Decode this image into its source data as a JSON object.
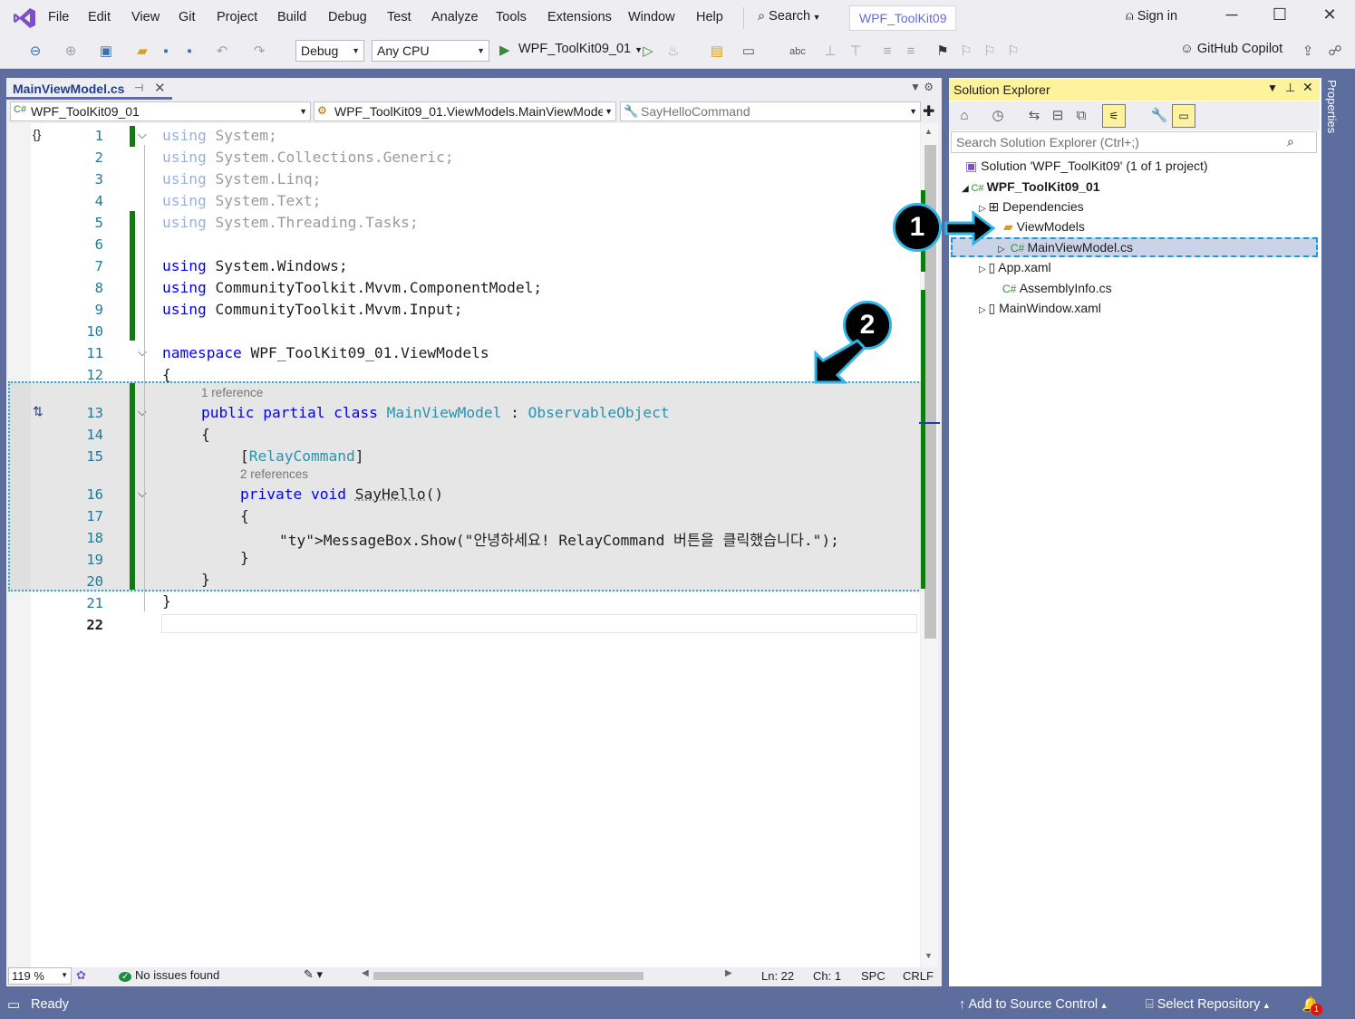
{
  "menubar": {
    "items": [
      "File",
      "Edit",
      "View",
      "Git",
      "Project",
      "Build",
      "Debug",
      "Test",
      "Analyze",
      "Tools",
      "Extensions",
      "Window",
      "Help"
    ],
    "search": "Search",
    "solution_title": "WPF_ToolKit09",
    "sign_in": "Sign in"
  },
  "toolbar": {
    "config": "Debug",
    "platform": "Any CPU",
    "startup_project": "WPF_ToolKit09_01",
    "copilot": "GitHub Copilot"
  },
  "editor": {
    "tab_label": "MainViewModel.cs",
    "nav_project": "WPF_ToolKit09_01",
    "nav_type": "WPF_ToolKit09_01.ViewModels.MainViewModel",
    "nav_member": "SayHelloCommand",
    "lines": [
      {
        "n": "1",
        "text": "using System;"
      },
      {
        "n": "2",
        "text": "using System.Collections.Generic;"
      },
      {
        "n": "3",
        "text": "using System.Linq;"
      },
      {
        "n": "4",
        "text": "using System.Text;"
      },
      {
        "n": "5",
        "text": "using System.Threading.Tasks;"
      },
      {
        "n": "6",
        "text": ""
      },
      {
        "n": "7",
        "text": "using System.Windows;"
      },
      {
        "n": "8",
        "text": "using CommunityToolkit.Mvvm.ComponentModel;"
      },
      {
        "n": "9",
        "text": "using CommunityToolkit.Mvvm.Input;"
      },
      {
        "n": "10",
        "text": ""
      },
      {
        "n": "11",
        "text": "namespace WPF_ToolKit09_01.ViewModels"
      },
      {
        "n": "12",
        "text": "{"
      },
      {
        "n": "13",
        "text": "public partial class MainViewModel : ObservableObject"
      },
      {
        "n": "14",
        "text": "{"
      },
      {
        "n": "15",
        "text": "[RelayCommand]"
      },
      {
        "n": "16",
        "text": "private void SayHello()"
      },
      {
        "n": "17",
        "text": "{"
      },
      {
        "n": "18",
        "text": "MessageBox.Show(\"안녕하세요! RelayCommand 버튼을 클릭했습니다.\");"
      },
      {
        "n": "19",
        "text": "}"
      },
      {
        "n": "20",
        "text": "}"
      },
      {
        "n": "21",
        "text": "}"
      },
      {
        "n": "22",
        "text": ""
      }
    ],
    "lens_1": "1 reference",
    "lens_2": "2 references",
    "zoom": "119 %",
    "issues": "No issues found",
    "ln": "Ln: 22",
    "ch": "Ch: 1",
    "spc": "SPC",
    "crlf": "CRLF"
  },
  "solution_explorer": {
    "title": "Solution Explorer",
    "search_placeholder": "Search Solution Explorer (Ctrl+;)",
    "solution": "Solution 'WPF_ToolKit09' (1 of 1 project)",
    "project": "WPF_ToolKit09_01",
    "dependencies": "Dependencies",
    "viewmodels": "ViewModels",
    "mainviewmodel": "MainViewModel.cs",
    "app_xaml": "App.xaml",
    "assemblyinfo": "AssemblyInfo.cs",
    "mainwindow": "MainWindow.xaml",
    "properties_tab": "Properties"
  },
  "annotations": {
    "badge1": "1",
    "badge2": "2"
  },
  "statusbar": {
    "ready": "Ready",
    "add_source": "Add to Source Control",
    "select_repo": "Select Repository",
    "notification_count": "1"
  }
}
